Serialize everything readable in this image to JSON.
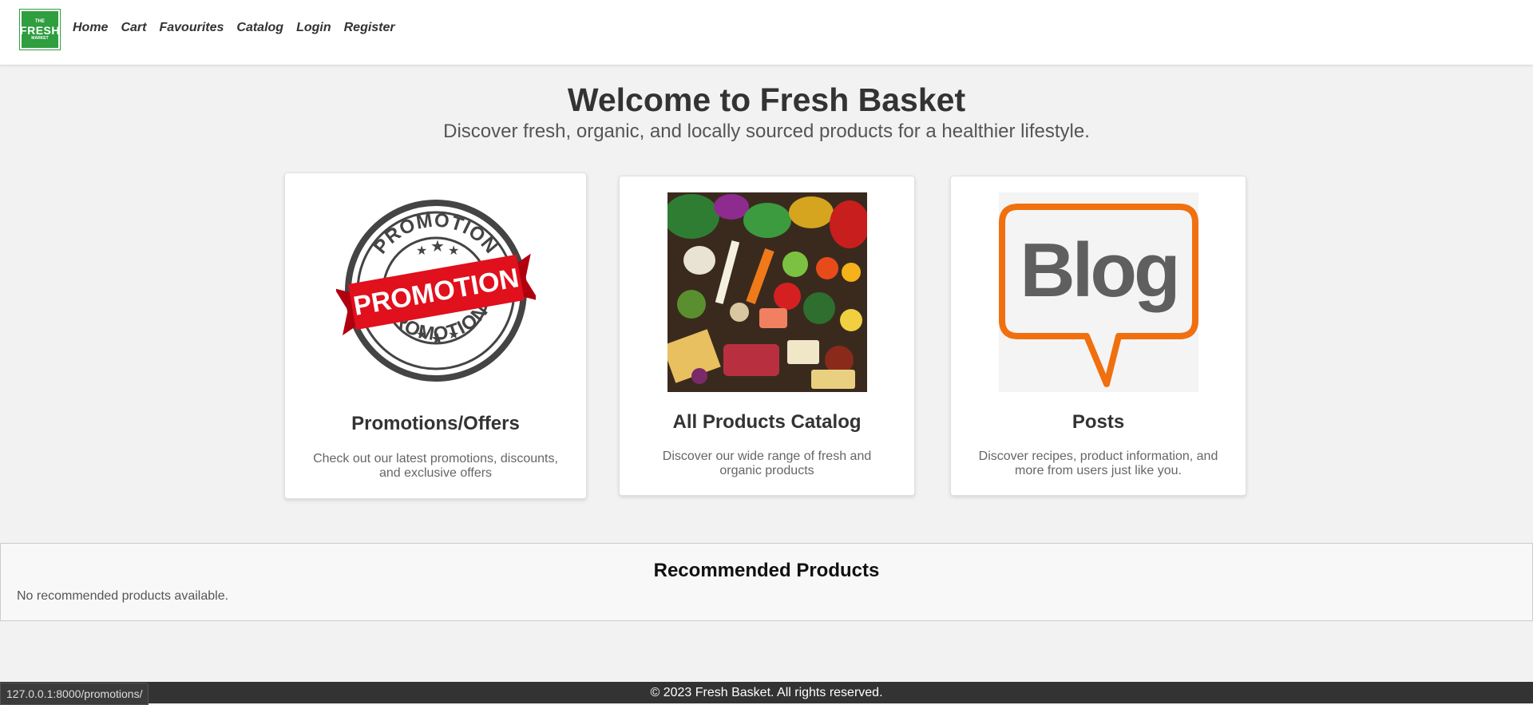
{
  "brand": {
    "logo_line1": "THE",
    "logo_line2": "FRESH",
    "logo_line3": "MARKET",
    "color": "#2e9e3f"
  },
  "nav": {
    "items": [
      {
        "label": "Home"
      },
      {
        "label": "Cart"
      },
      {
        "label": "Favourites"
      },
      {
        "label": "Catalog"
      },
      {
        "label": "Login"
      },
      {
        "label": "Register"
      }
    ]
  },
  "hero": {
    "title": "Welcome to Fresh Basket",
    "subtitle": "Discover fresh, organic, and locally sourced products for a healthier lifestyle."
  },
  "cards": [
    {
      "image": "promotion-badge-image",
      "title": "Promotions/Offers",
      "description": "Check out our latest promotions, discounts, and exclusive offers",
      "badge_text_top": "PROMOTION",
      "badge_text_ribbon": "PROMOTION",
      "badge_text_bottom": "PROMOTION"
    },
    {
      "image": "vegetables-image",
      "title": "All Products Catalog",
      "description": "Discover our wide range of fresh and organic products"
    },
    {
      "image": "blog-bubble-image",
      "title": "Posts",
      "description": "Discover recipes, product information, and more from users just like you.",
      "image_text": "Blog"
    }
  ],
  "recommended": {
    "title": "Recommended Products",
    "empty_message": "No recommended products available."
  },
  "footer": {
    "text": "© 2023 Fresh Basket. All rights reserved."
  },
  "status_bar": {
    "url": "127.0.0.1:8000/promotions/"
  }
}
